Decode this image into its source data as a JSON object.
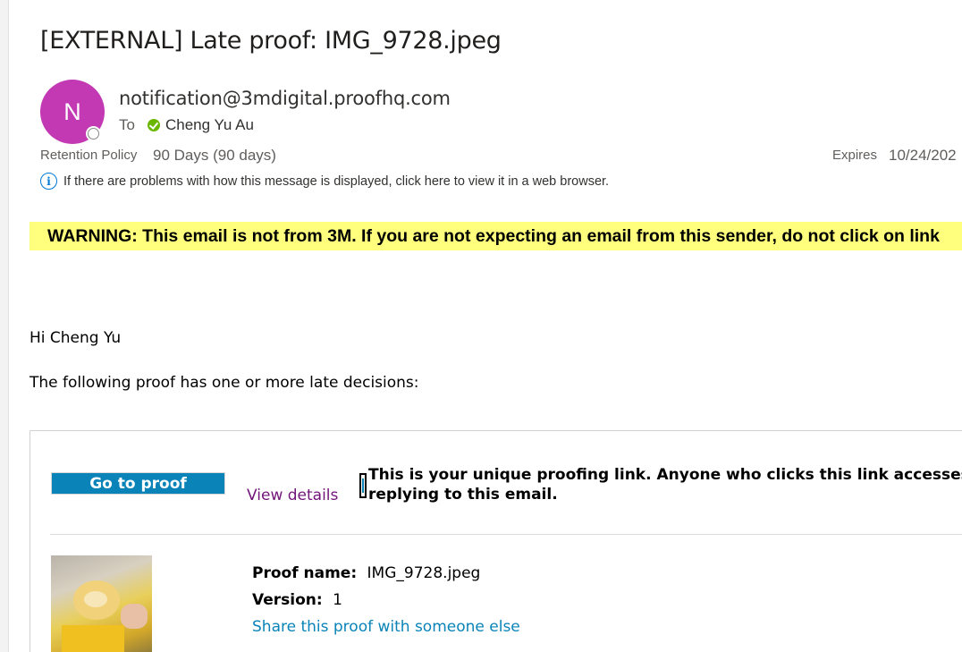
{
  "header": {
    "subject": "[EXTERNAL] Late proof: IMG_9728.jpeg",
    "avatar_initial": "N",
    "sender": "notification@3mdigital.proofhq.com",
    "to_label": "To",
    "recipient": "Cheng Yu Au",
    "retention_label": "Retention Policy",
    "retention_value": "90 Days (90 days)",
    "expires_label": "Expires",
    "expires_value": "10/24/202",
    "info_message": "If there are problems with how this message is displayed, click here to view it in a web browser."
  },
  "body": {
    "warning": "WARNING: This email is not from 3M. If you are not expecting an email from this sender, do not click on link",
    "greeting": "Hi Cheng Yu",
    "intro": "The following proof has one or more late decisions:",
    "go_to_proof": "Go to proof",
    "view_details": "View details",
    "notice_line1": "This is your unique proofing link. Anyone who clicks this link accesses",
    "notice_line2": "replying to this email.",
    "proof_name_label": "Proof name:",
    "proof_name_value": "IMG_9728.jpeg",
    "version_label": "Version:",
    "version_value": "1",
    "share_link": "Share this proof with someone else"
  },
  "colors": {
    "avatar": "#c239b3",
    "warning_bg": "#ffff7d",
    "button_bg": "#0a84b8",
    "link_visited": "#72157a",
    "link": "#0a84b8",
    "presence_ok": "#6bb700"
  },
  "icons": [
    "presence-icon",
    "check-icon",
    "info-icon",
    "text-cursor-icon"
  ]
}
